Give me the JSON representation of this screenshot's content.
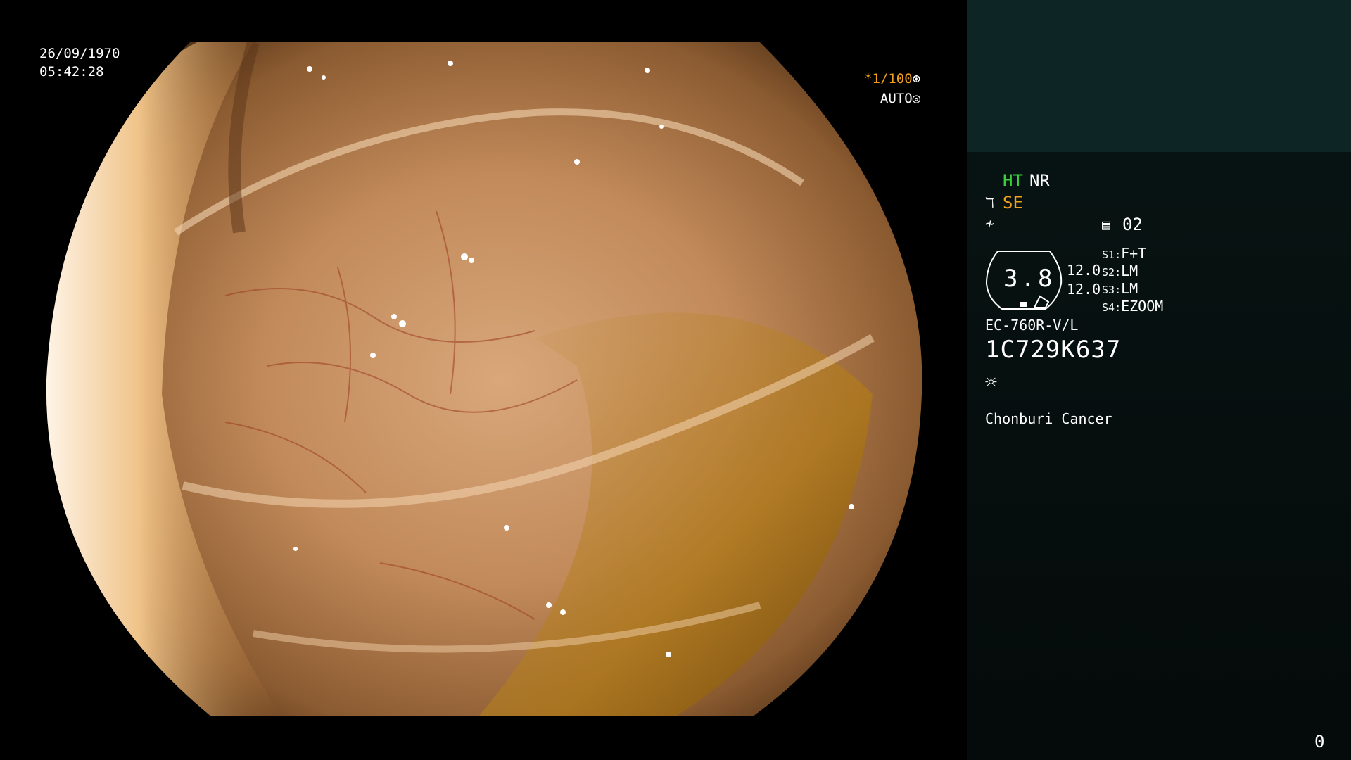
{
  "overlay": {
    "date": "26/09/1970",
    "time": "05:42:28",
    "shutter": "*1/100",
    "shutter_icon": "aperture-icon",
    "iris": "AUTO",
    "iris_icon": "iris-icon"
  },
  "panel": {
    "ht": "HT",
    "nr": "NR",
    "se": "SE",
    "se_icon": "scope-icon",
    "lightning_icon": "flash-icon",
    "record_icon": "storage-icon",
    "record_count": "02",
    "magnification": "3.8",
    "mag_val_a": "12.0",
    "mag_val_b": "12.0",
    "switches": [
      {
        "key": "S1",
        "value": "F+T"
      },
      {
        "key": "S2",
        "value": "LM"
      },
      {
        "key": "S3",
        "value": "LM"
      },
      {
        "key": "S4",
        "value": "EZOOM"
      }
    ],
    "model": "EC-760R-V/L",
    "serial": "1C729K637",
    "light_icon": "sun-icon",
    "institution": "Chonburi Cancer",
    "counter": "0"
  },
  "colors": {
    "panel_top": "#0e2526",
    "panel_bottom": "#061110",
    "accent_green": "#39d23a",
    "accent_orange": "#f0a21e"
  }
}
